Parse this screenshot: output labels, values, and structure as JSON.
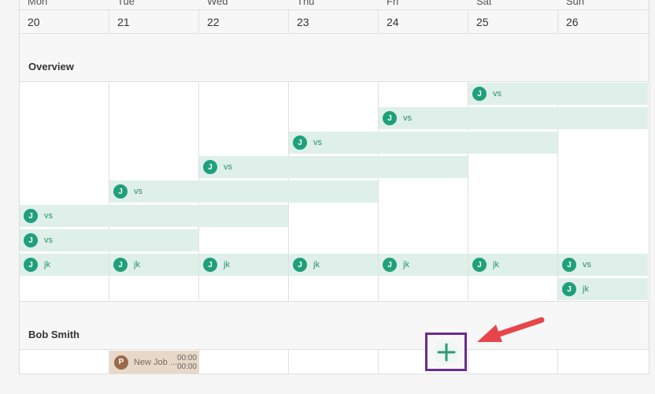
{
  "days": [
    {
      "name": "Mon",
      "num": "20"
    },
    {
      "name": "Tue",
      "num": "21"
    },
    {
      "name": "Wed",
      "num": "22"
    },
    {
      "name": "Thu",
      "num": "23"
    },
    {
      "name": "Fri",
      "num": "24"
    },
    {
      "name": "Sat",
      "num": "25"
    },
    {
      "name": "Sun",
      "num": "26"
    }
  ],
  "sections": {
    "overview": "Overview",
    "bob": "Bob Smith"
  },
  "avatar_initial": "J",
  "labels": {
    "vs": "vs",
    "jk": "jk"
  },
  "job": {
    "initial": "P",
    "title": "New Job ...",
    "start": "00:00",
    "end": "00:00"
  },
  "colors": {
    "accent": "#1fa07a",
    "bar": "#dff0ea",
    "job": "#e8d8c8",
    "highlight": "#6a2c8e",
    "arrow": "#e8454a"
  },
  "icons": {
    "add": "plus-icon",
    "pointer": "arrow-icon"
  }
}
